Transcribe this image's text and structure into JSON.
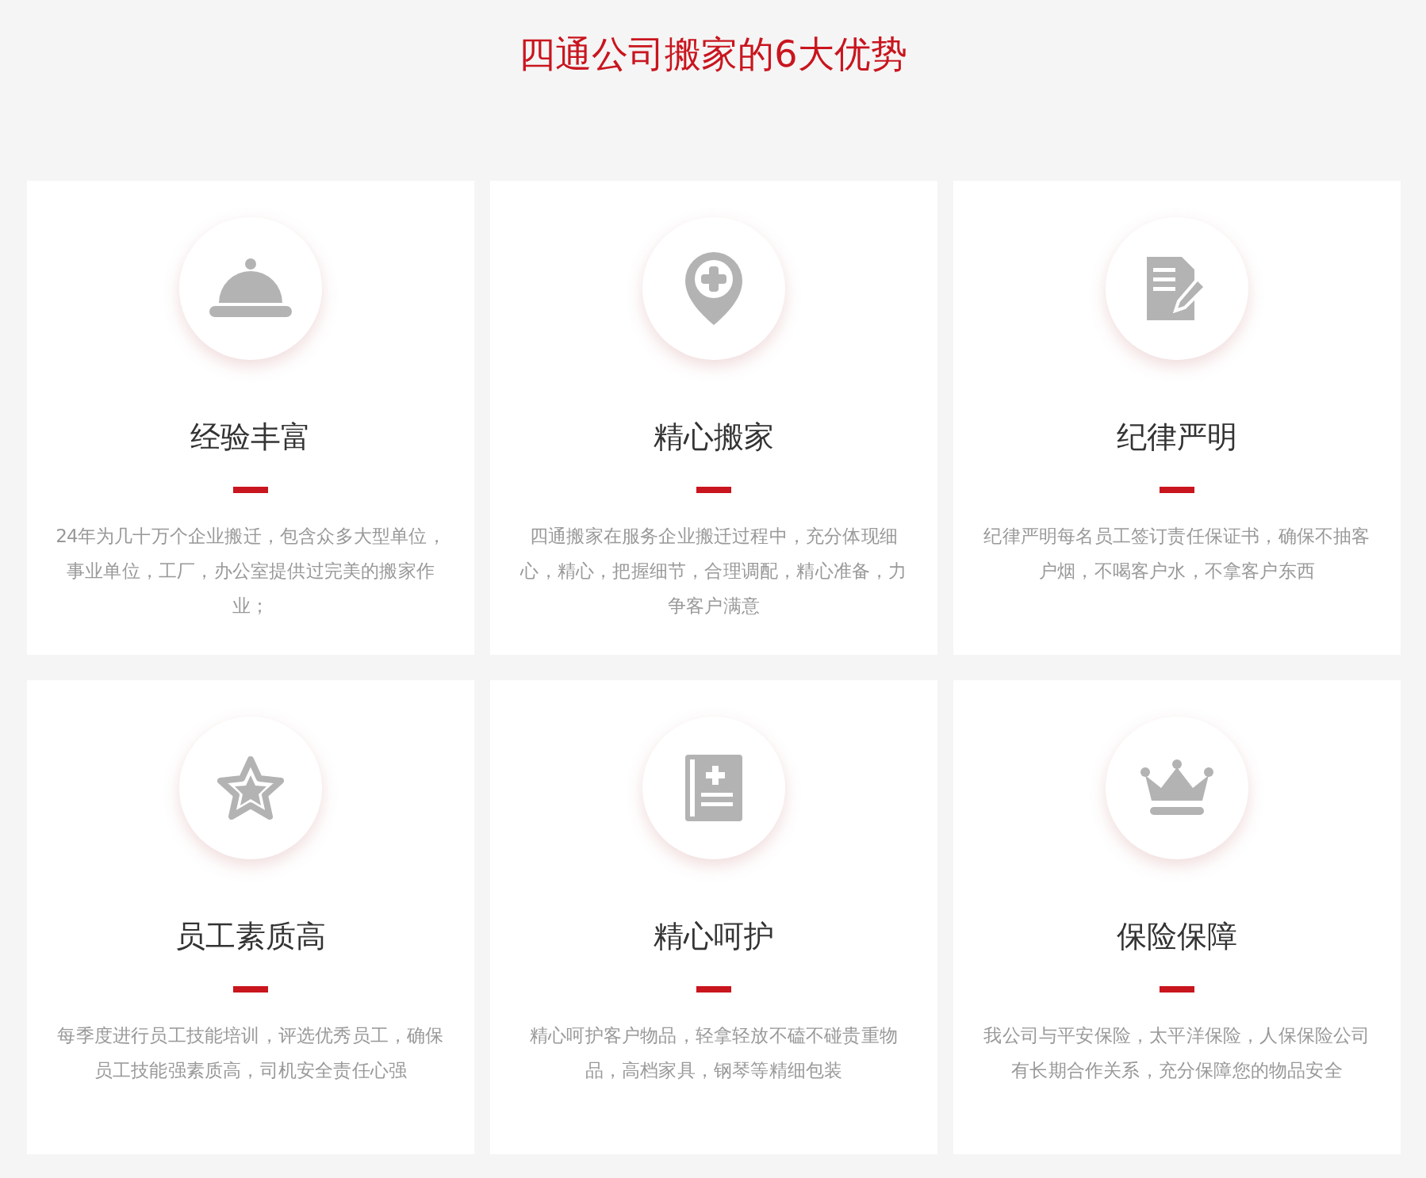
{
  "title": "四通公司搬家的6大优势",
  "cards": [
    {
      "heading": "经验丰富",
      "text": "24年为几十万个企业搬迁，包含众多大型单位，事业单位，工厂，办公室提供过完美的搬家作业；"
    },
    {
      "heading": "精心搬家",
      "text": "四通搬家在服务企业搬迁过程中，充分体现细心，精心，把握细节，合理调配，精心准备，力争客户满意"
    },
    {
      "heading": "纪律严明",
      "text": "纪律严明每名员工签订责任保证书，确保不抽客户烟，不喝客户水，不拿客户东西"
    },
    {
      "heading": "员工素质高",
      "text": "每季度进行员工技能培训，评选优秀员工，确保员工技能强素质高，司机安全责任心强"
    },
    {
      "heading": "精心呵护",
      "text": "精心呵护客户物品，轻拿轻放不磕不碰贵重物品，高档家具，钢琴等精细包装"
    },
    {
      "heading": "保险保障",
      "text": "我公司与平安保险，太平洋保险，人保保险公司有长期合作关系，充分保障您的物品安全"
    }
  ]
}
